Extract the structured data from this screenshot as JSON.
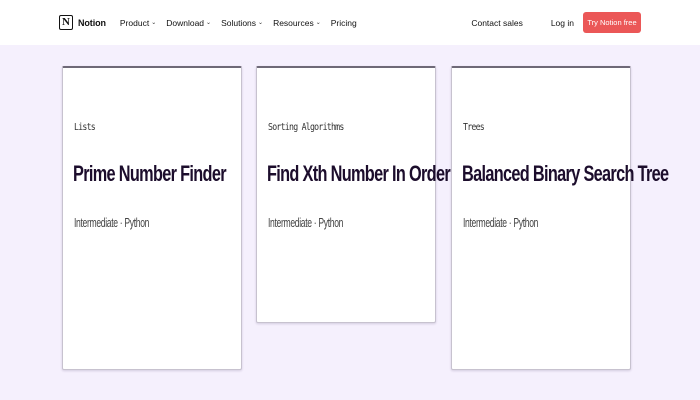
{
  "nav": {
    "brand": "Notion",
    "logo_letter": "N",
    "menu": [
      {
        "label": "Product",
        "has_dropdown": true
      },
      {
        "label": "Download",
        "has_dropdown": true
      },
      {
        "label": "Solutions",
        "has_dropdown": true
      },
      {
        "label": "Resources",
        "has_dropdown": true
      },
      {
        "label": "Pricing",
        "has_dropdown": false
      }
    ],
    "contact_sales": "Contact sales",
    "login": "Log in",
    "cta": "Try Notion free",
    "chevron_glyph": "⌄"
  },
  "cards": [
    {
      "category": "Lists",
      "title": "Prime Number Finder",
      "meta": "Intermediate · Python"
    },
    {
      "category": "Sorting Algorithms",
      "title": "Find Xth Number In Order",
      "meta": "Intermediate · Python"
    },
    {
      "category": "Trees",
      "title": "Balanced Binary Search Tree",
      "meta": "Intermediate · Python"
    }
  ],
  "colors": {
    "background": "#f5f0fd",
    "cta": "#eb5757",
    "card_title": "#1c0d2c"
  }
}
